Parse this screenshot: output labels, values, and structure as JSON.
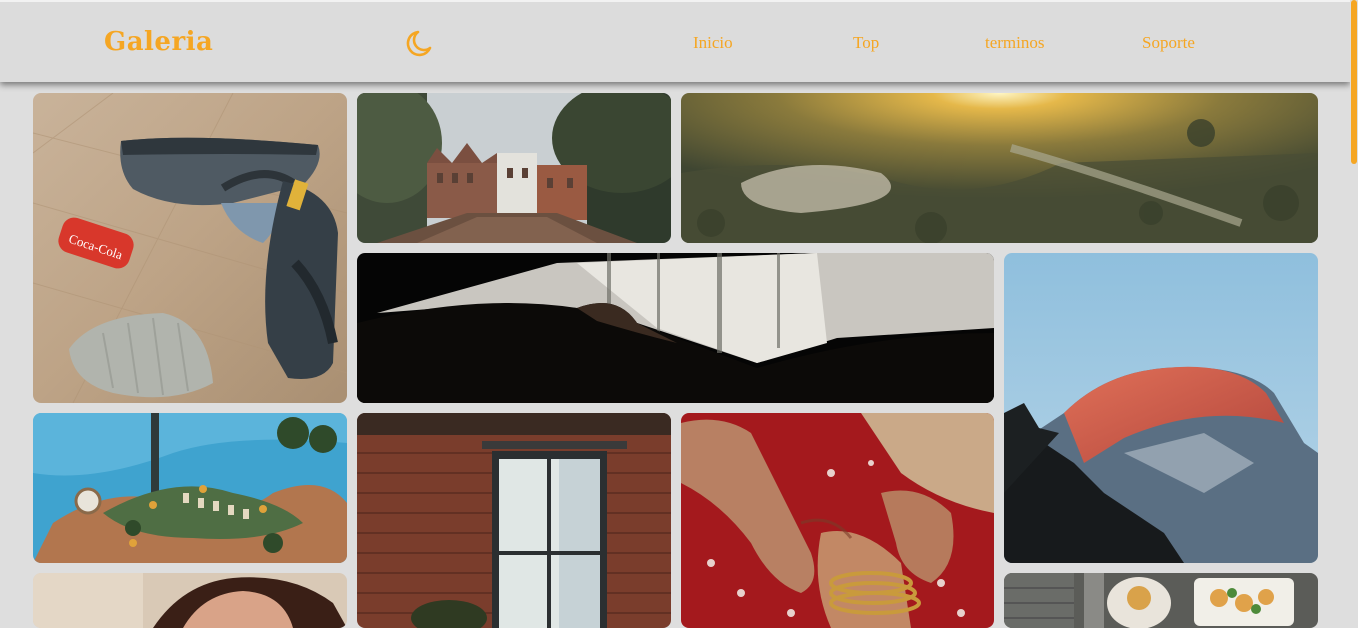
{
  "header": {
    "logo": "Galeria",
    "theme_toggle_icon": "moon-icon",
    "nav": [
      {
        "label": "Inicio"
      },
      {
        "label": "Top"
      },
      {
        "label": "terminos"
      },
      {
        "label": "Soporte"
      }
    ]
  },
  "colors": {
    "accent": "#f5a623",
    "background": "#dedede",
    "navbar": "#dcdcdc"
  },
  "gallery": {
    "photos": [
      {
        "subject": "sneakers-and-soda-can"
      },
      {
        "subject": "canal-town-street"
      },
      {
        "subject": "sunset-valley"
      },
      {
        "subject": "dark-forest-silhouette"
      },
      {
        "subject": "mountain-peak-at-dusk"
      },
      {
        "subject": "aerial-pool-resort"
      },
      {
        "subject": "brick-wall-window"
      },
      {
        "subject": "hands-with-bangles"
      },
      {
        "subject": "woman-portrait"
      },
      {
        "subject": "food-platter"
      }
    ]
  }
}
